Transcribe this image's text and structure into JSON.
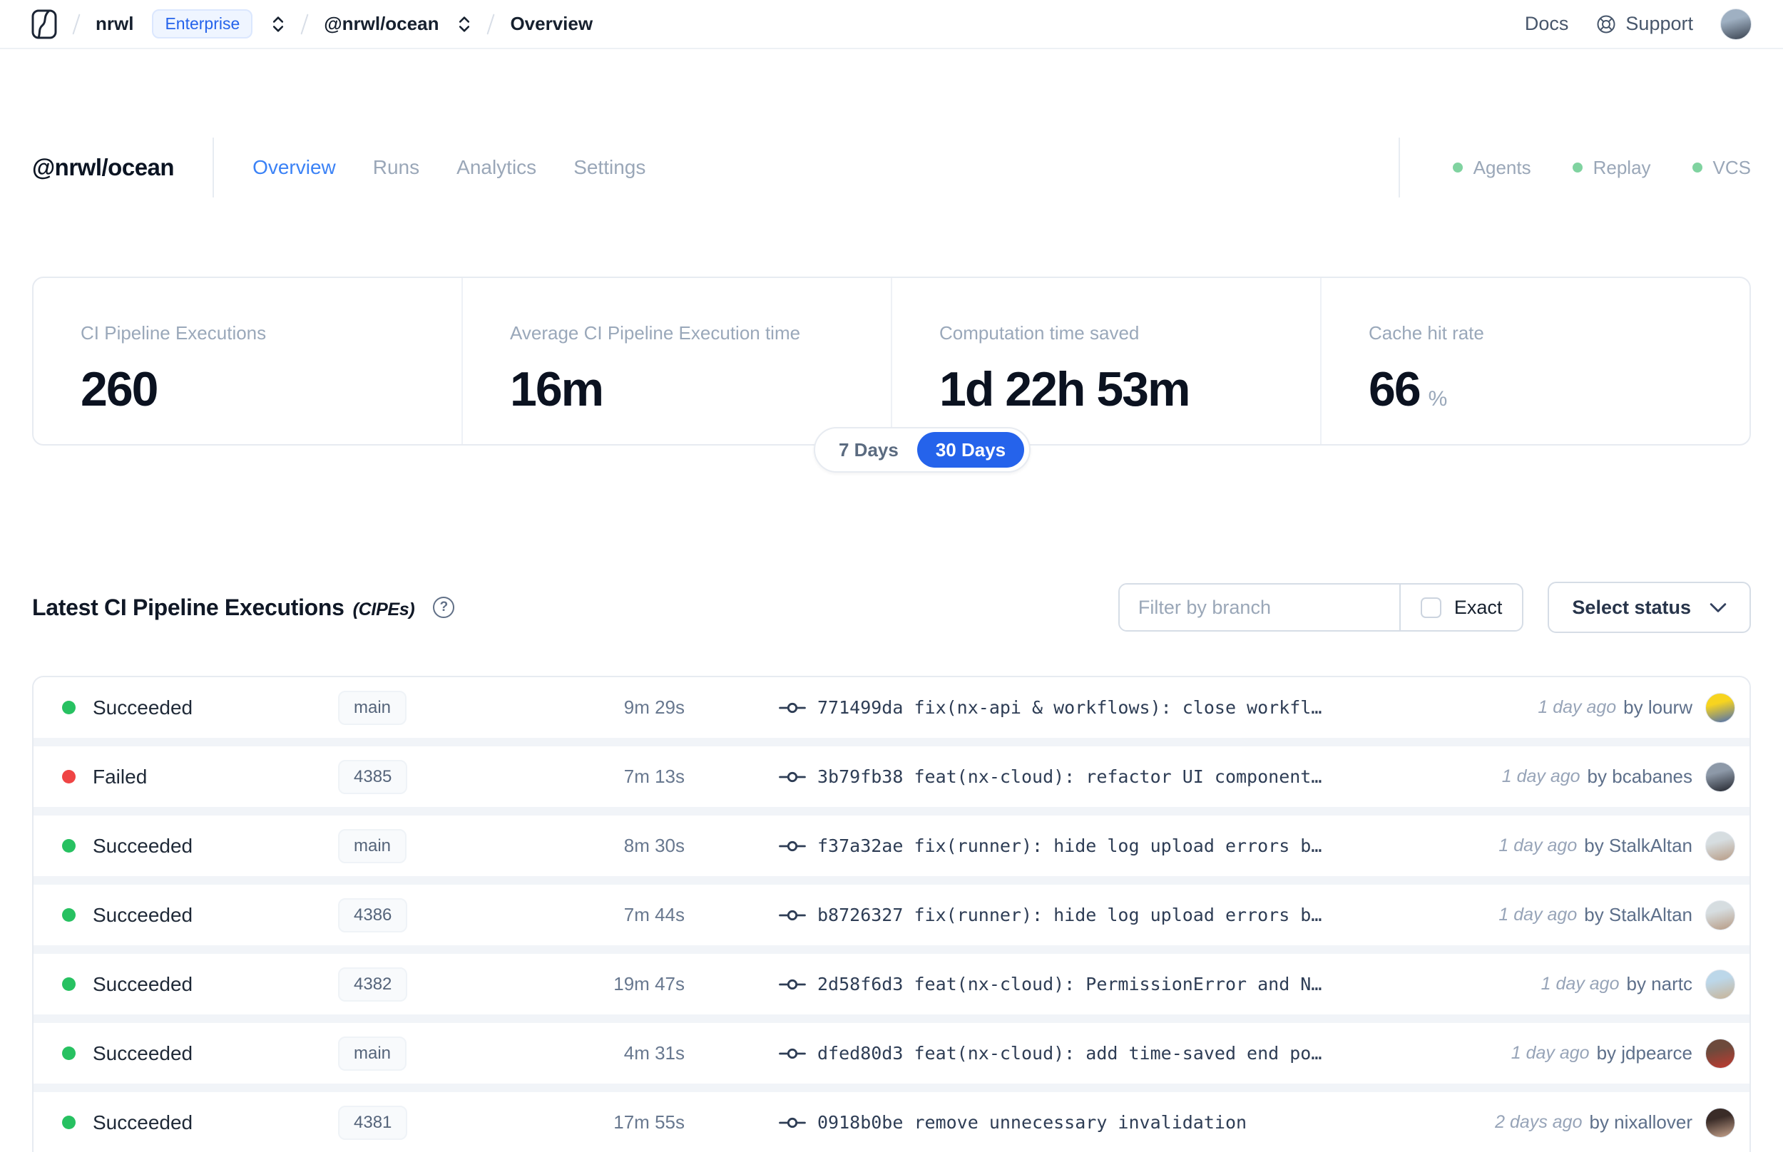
{
  "topbar": {
    "breadcrumb": {
      "org": "nrwl",
      "org_badge": "Enterprise",
      "workspace": "@nrwl/ocean",
      "page": "Overview"
    },
    "links": {
      "docs": "Docs",
      "support": "Support"
    },
    "avatar": {
      "from": "#9fb0c2",
      "to": "#39424f"
    }
  },
  "header": {
    "title": "@nrwl/ocean",
    "tabs": [
      {
        "label": "Overview",
        "active": true
      },
      {
        "label": "Runs",
        "active": false
      },
      {
        "label": "Analytics",
        "active": false
      },
      {
        "label": "Settings",
        "active": false
      }
    ],
    "features": [
      {
        "label": "Agents"
      },
      {
        "label": "Replay"
      },
      {
        "label": "VCS"
      }
    ]
  },
  "stats": {
    "cards": [
      {
        "label": "CI Pipeline Executions",
        "value": "260"
      },
      {
        "label": "Average CI Pipeline Execution time",
        "value": "16m"
      },
      {
        "label": "Computation time saved",
        "value": "1d 22h 53m"
      },
      {
        "label": "Cache hit rate",
        "value": "66",
        "suffix": "%"
      }
    ],
    "range_toggle": {
      "options": [
        "7 Days",
        "30 Days"
      ],
      "selected": "30 Days"
    }
  },
  "section": {
    "title": "Latest CI Pipeline Executions",
    "title_suffix": "(CIPEs)",
    "filter_placeholder": "Filter by branch",
    "exact_label": "Exact",
    "status_label": "Select status"
  },
  "table": {
    "rows": [
      {
        "status": "Succeeded",
        "dot_color": "#27c161",
        "branch": "main",
        "duration": "9m 29s",
        "commit": "771499da fix(nx-api & workflows): close workfl…",
        "time_ago": "1 day ago",
        "author_label": "by lourw",
        "avatar": {
          "from": "#f7d41f",
          "to": "#4a6db5"
        }
      },
      {
        "status": "Failed",
        "dot_color": "#ef4444",
        "branch": "4385",
        "duration": "7m 13s",
        "commit": "3b79fb38 feat(nx-cloud): refactor UI component…",
        "time_ago": "1 day ago",
        "author_label": "by bcabanes",
        "avatar": {
          "from": "#8d99a8",
          "to": "#23252d"
        }
      },
      {
        "status": "Succeeded",
        "dot_color": "#27c161",
        "branch": "main",
        "duration": "8m 30s",
        "commit": "f37a32ae fix(runner): hide log upload errors b…",
        "time_ago": "1 day ago",
        "author_label": "by StalkAltan",
        "avatar": {
          "from": "#d6dde0",
          "to": "#b79a83"
        }
      },
      {
        "status": "Succeeded",
        "dot_color": "#27c161",
        "branch": "4386",
        "duration": "7m 44s",
        "commit": "b8726327 fix(runner): hide log upload errors b…",
        "time_ago": "1 day ago",
        "author_label": "by StalkAltan",
        "avatar": {
          "from": "#d6dde0",
          "to": "#b79a83"
        }
      },
      {
        "status": "Succeeded",
        "dot_color": "#27c161",
        "branch": "4382",
        "duration": "19m 47s",
        "commit": "2d58f6d3 feat(nx-cloud): PermissionError and N…",
        "time_ago": "1 day ago",
        "author_label": "by nartc",
        "avatar": {
          "from": "#bcd7e9",
          "to": "#c8b396"
        }
      },
      {
        "status": "Succeeded",
        "dot_color": "#27c161",
        "branch": "main",
        "duration": "4m 31s",
        "commit": "dfed80d3 feat(nx-cloud): add time-saved end po…",
        "time_ago": "1 day ago",
        "author_label": "by jdpearce",
        "avatar": {
          "from": "#6d4a3c",
          "to": "#c23a30"
        }
      },
      {
        "status": "Succeeded",
        "dot_color": "#27c161",
        "branch": "4381",
        "duration": "17m 55s",
        "commit": "0918b0be remove unnecessary invalidation",
        "time_ago": "2 days ago",
        "author_label": "by nixallover",
        "avatar": {
          "from": "#3a2c28",
          "to": "#c9a58e"
        }
      }
    ]
  },
  "colors": {
    "accent": "#2563eb",
    "active_tab": "#3b82f6",
    "feature_dot": "#80d3a0",
    "success_dot": "#27c161",
    "failed_dot": "#ef4444"
  }
}
